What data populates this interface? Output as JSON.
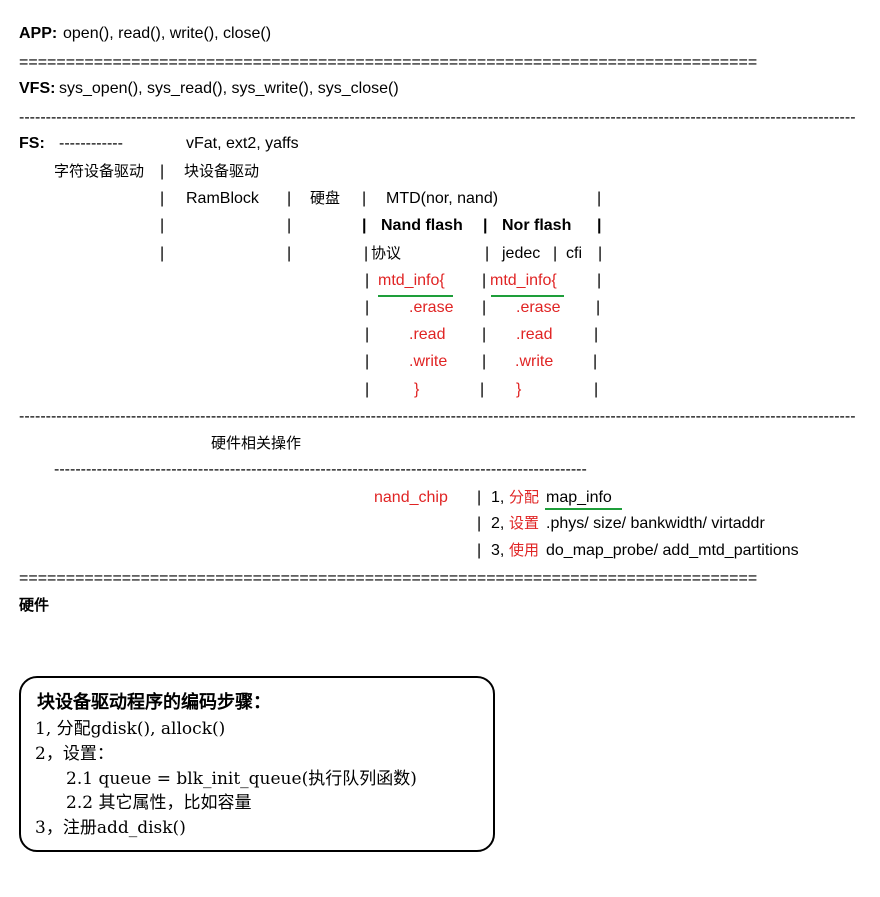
{
  "app": {
    "label": "APP:",
    "calls": "open(), read(), write(), close()"
  },
  "vfs": {
    "label": "VFS:",
    "calls": "sys_open(), sys_read(), sys_write(), sys_close()"
  },
  "rules": {
    "double": "===============================================================================",
    "single": "-------------------------------------------------------------------------------------------------------------------------------------------------------------",
    "short": "-------------------------------------------------------------------------------------------------------------"
  },
  "fs": {
    "label": "FS:",
    "dashes": "------------",
    "filesystems": "vFat, ext2, yaffs",
    "char_driver": "字符设备驱动",
    "block_driver": "块设备驱动",
    "ramblock": "RamBlock",
    "harddisk": "硬盘",
    "mtd": "MTD(nor, nand)",
    "nand_flash": "Nand flash",
    "nor_flash": "Nor flash",
    "protocol": "协议",
    "jedec": "jedec",
    "cfi": "cfi",
    "mtd_info": "mtd_info{",
    "erase": ".erase",
    "read": ".read",
    "write": ".write",
    "close_brace": "}",
    "sep": "|"
  },
  "hardware_ops": {
    "title": "硬件相关操作",
    "nand_chip": "nand_chip",
    "step1_num": "1,",
    "step1_verb": "分配",
    "step1_obj": "map_info",
    "step2_num": "2,",
    "step2_verb": "设置",
    "step2_obj": ".phys/ size/ bankwidth/ virtaddr",
    "step3_num": "3,",
    "step3_verb": "使用",
    "step3_obj": "do_map_probe/ add_mtd_partitions"
  },
  "hardware": {
    "label": "硬件"
  },
  "steps_box": {
    "title": "块设备驱动程序的编码步骤：",
    "line1": "1, 分配gdisk(), allock()",
    "line2": "2，设置：",
    "line3": "2.1 queue = blk_init_queue(执行队列函数)",
    "line4": "2.2 其它属性，比如容量",
    "line5": "3，注册add_disk()"
  },
  "colors": {
    "red": "#e02424",
    "underline": "#1e9e3a"
  }
}
